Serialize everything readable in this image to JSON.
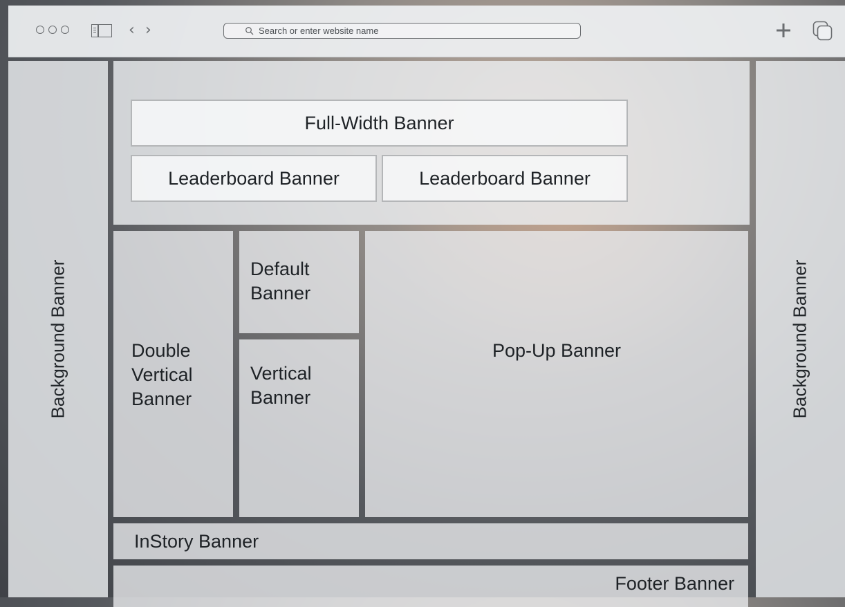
{
  "browser": {
    "address_placeholder": "Search or enter website name",
    "new_tab_icon": "plus-icon",
    "tabs_icon": "tabs-overview-icon"
  },
  "banners": {
    "background_left": "Background Banner",
    "background_right": "Background Banner",
    "full_width": "Full-Width Banner",
    "leaderboard_1": "Leaderboard Banner",
    "leaderboard_2": "Leaderboard Banner",
    "double_vertical": [
      "Double",
      "Vertical",
      "Banner"
    ],
    "default": [
      "Default",
      "Banner"
    ],
    "vertical": [
      "Vertical",
      "Banner"
    ],
    "popup": "Pop-Up Banner",
    "instory": "InStory Banner",
    "footer": "Footer Banner"
  }
}
